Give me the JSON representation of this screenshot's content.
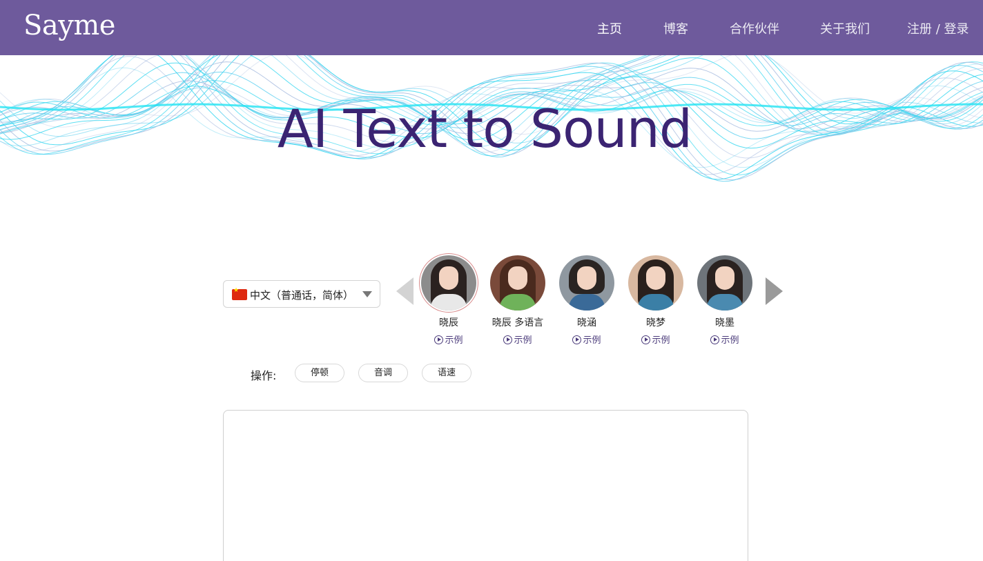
{
  "header": {
    "logo": "Sayme",
    "nav": {
      "home": "主页",
      "blog": "博客",
      "partners": "合作伙伴",
      "about": "关于我们",
      "auth": "注册 / 登录"
    }
  },
  "hero": {
    "title": "AI Text to Sound"
  },
  "language": {
    "selected": "中文（普通话，简体）",
    "flag": "china-flag"
  },
  "voices": [
    {
      "name": "晓辰",
      "sample": "示例",
      "selected": true
    },
    {
      "name": "晓辰 多语言",
      "sample": "示例",
      "selected": false
    },
    {
      "name": "晓涵",
      "sample": "示例",
      "selected": false
    },
    {
      "name": "晓梦",
      "sample": "示例",
      "selected": false
    },
    {
      "name": "晓墨",
      "sample": "示例",
      "selected": false
    }
  ],
  "operations": {
    "label": "操作:",
    "pause": "停顿",
    "pitch": "音调",
    "speed": "语速"
  },
  "editor": {
    "value": ""
  },
  "colors": {
    "header_bg": "#6e5a9c",
    "title": "#3b2472",
    "accent": "#4a3a7a",
    "wave": "#22d3ee"
  }
}
